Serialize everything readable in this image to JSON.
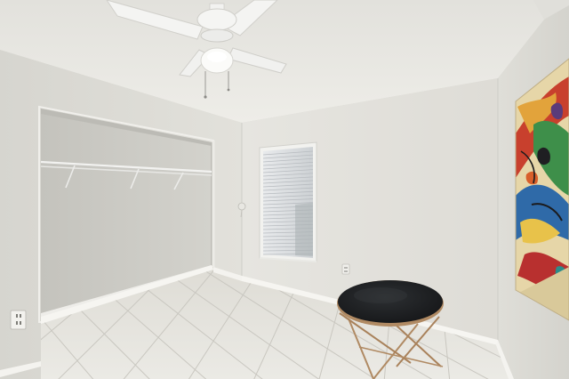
{
  "scene": {
    "colors": {
      "ceiling": "#e9e8e3",
      "wall_left": "#dedcd6",
      "wall_back": "#e4e3de",
      "wall_right": "#dcdbd5",
      "closet_interior": "#cfcec8",
      "floor_tile": "#e3e2dd",
      "grout": "#c9c7c0",
      "baseboard": "#f4f3ef",
      "table_top": "#1e2022",
      "table_frame": "#b08a63"
    },
    "icons": [
      "ceiling-fan-icon",
      "window-blinds-icon",
      "closet-rod-icon",
      "power-outlet-icon",
      "side-table-icon",
      "abstract-painting-icon"
    ]
  }
}
